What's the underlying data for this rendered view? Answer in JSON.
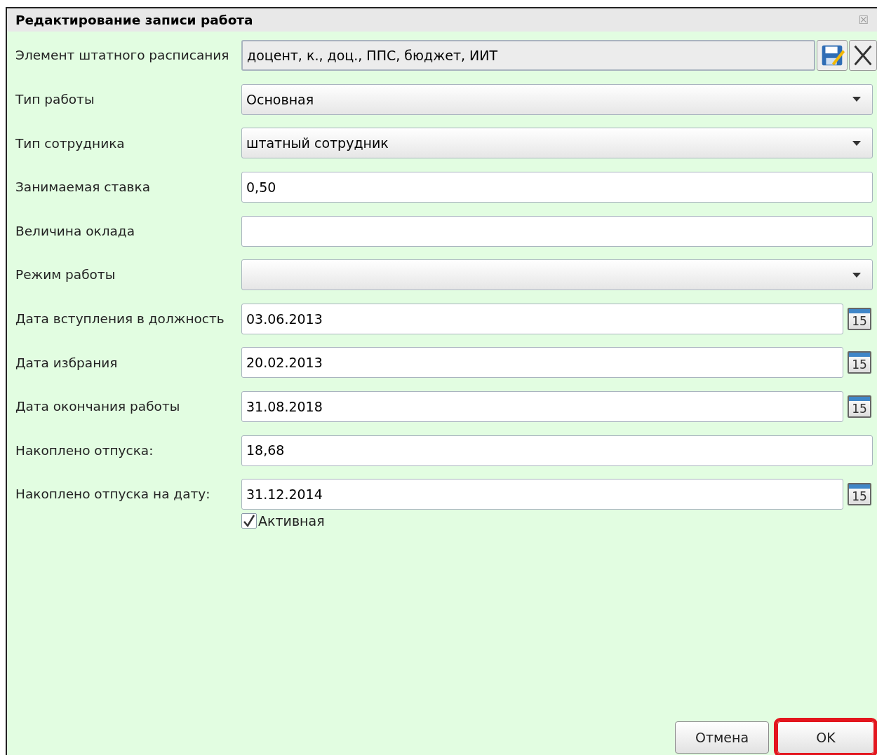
{
  "window": {
    "title": "Редактирование записи работа",
    "close_glyph": "☒"
  },
  "fields": [
    {
      "kind": "lookup",
      "label": "Элемент штатного расписания",
      "value": "доцент, к., доц., ППС, бюджет, ИИТ"
    },
    {
      "kind": "select",
      "label": "Тип работы",
      "value": "Основная"
    },
    {
      "kind": "select",
      "label": "Тип сотрудника",
      "value": "штатный сотрудник"
    },
    {
      "kind": "text",
      "label": "Занимаемая ставка",
      "value": "0,50"
    },
    {
      "kind": "text",
      "label": "Величина оклада"
    },
    {
      "kind": "select",
      "label": "Режим работы"
    },
    {
      "kind": "date",
      "label": "Дата вступления в должность",
      "value": "03.06.2013",
      "calendar_day": "15"
    },
    {
      "kind": "date",
      "label": "Дата избрания",
      "value": "20.02.2013",
      "calendar_day": "15"
    },
    {
      "kind": "date",
      "label": "Дата окончания работы",
      "value": "31.08.2018",
      "calendar_day": "15"
    },
    {
      "kind": "text",
      "label": "Накоплено отпуска:",
      "value": "18,68"
    },
    {
      "kind": "date",
      "label": "Накоплено отпуска на дату:",
      "value": "31.12.2014",
      "calendar_day": "15"
    }
  ],
  "active_checkbox": {
    "label": "Активная",
    "checked": true
  },
  "buttons": [
    {
      "label": "Отмена",
      "highlighted": false
    },
    {
      "label": "OK",
      "highlighted": true
    }
  ]
}
